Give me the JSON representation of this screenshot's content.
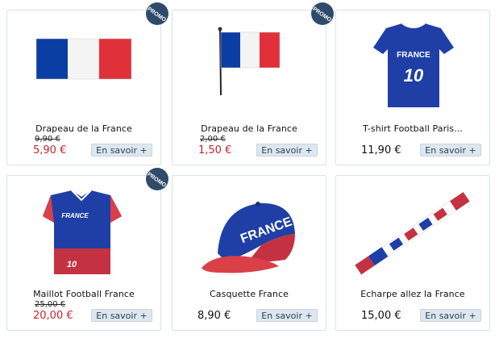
{
  "products": [
    {
      "title": "Drapeau de la France",
      "old_price": "9,90 €",
      "price": "5,90 €",
      "button": "En savoir +",
      "badge": "PROMO"
    },
    {
      "title": "Drapeau de la France",
      "old_price": "2,00 €",
      "price": "1,50 €",
      "button": "En savoir +",
      "badge": "PROMO"
    },
    {
      "title": "T-shirt Football Paris...",
      "price": "11,90 €",
      "button": "En savoir +",
      "shirt_text": "FRANCE",
      "shirt_number": "10"
    },
    {
      "title": "Maillot Football France",
      "old_price": "25,00 €",
      "price": "20,00 €",
      "button": "En savoir +",
      "badge": "PROMO",
      "shirt_text": "FRANCE",
      "shirt_number": "10"
    },
    {
      "title": "Casquette France",
      "price": "8,90 €",
      "button": "En savoir +",
      "cap_text": "FRANCE"
    },
    {
      "title": "Echarpe allez la France",
      "price": "15,00 €",
      "button": "En savoir +"
    }
  ],
  "colors": {
    "promo_price": "#c0262d",
    "flag_blue": "#0a3ea3",
    "flag_red": "#e0313a",
    "button_bg": "#dfe7ee"
  }
}
